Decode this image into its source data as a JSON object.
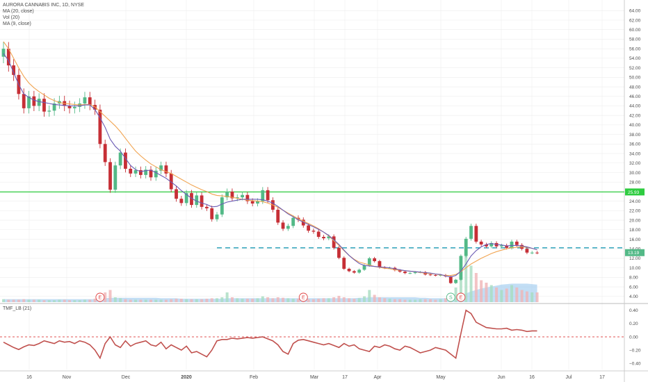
{
  "legend": {
    "title": "AURORA CANNABIS INC, 1D, NYSE",
    "ma20": "MA (20, close)",
    "vol": "Vol (20)",
    "ma9": "MA (9, close)"
  },
  "tmf_legend": "TMF_LB (21)",
  "colors": {
    "up": "#53b987",
    "down": "#c62f36",
    "ma20": "#f1a451",
    "ma9": "#6a5bb4",
    "support": "#2ecc40",
    "resistance": "#1d9bb5",
    "tmf": "#c0504d",
    "volume": "#90c2ec",
    "grid": "#eeeeee",
    "event_marker": "#e04040"
  },
  "chart_data": {
    "type": "candlestick",
    "title": "AURORA CANNABIS INC, 1D, NYSE",
    "y_ticks": [
      "64.00",
      "62.00",
      "60.00",
      "58.00",
      "56.00",
      "54.00",
      "52.00",
      "50.00",
      "48.00",
      "46.00",
      "44.00",
      "42.00",
      "40.00",
      "38.00",
      "36.00",
      "34.00",
      "32.00",
      "30.00",
      "28.00",
      "26.00",
      "24.00",
      "22.00",
      "20.00",
      "18.00",
      "16.00",
      "14.00",
      "12.00",
      "10.00",
      "8.00",
      "6.00",
      "4.00"
    ],
    "ylim": [
      2.8,
      65.5
    ],
    "x_labels": [
      "16",
      "Nov",
      "Dec",
      "2020",
      "Feb",
      "Mar",
      "17",
      "Apr",
      "May",
      "Jun",
      "16",
      "Jul",
      "17"
    ],
    "horizontal_lines": [
      {
        "price": 25.93,
        "label": "25.93",
        "style": "solid",
        "color": "#2ecc40"
      },
      {
        "price": 14.2,
        "label": "",
        "style": "dashed",
        "color": "#1d9bb5",
        "start_day": 42
      }
    ],
    "last_price_label": "13.19",
    "candles_close": [
      56.0,
      52.5,
      50.5,
      46.5,
      43.5,
      46.0,
      44.0,
      45.5,
      42.8,
      43.0,
      44.5,
      45.0,
      44.0,
      43.5,
      43.8,
      44.5,
      45.8,
      44.2,
      43.2,
      36.0,
      32.2,
      26.4,
      31.5,
      34.2,
      30.8,
      29.8,
      30.5,
      29.5,
      30.6,
      29.0,
      30.4,
      31.5,
      29.8,
      26.5,
      24.5,
      23.6,
      25.7,
      23.2,
      25.2,
      22.8,
      22.5,
      20.2,
      21.2,
      24.8,
      26.0,
      24.6,
      24.8,
      25.3,
      24.0,
      23.5,
      24.0,
      26.3,
      24.2,
      22.2,
      19.5,
      18.2,
      18.8,
      20.5,
      20.1,
      18.9,
      17.8,
      17.6,
      16.5,
      16.2,
      16.6,
      14.2,
      12.1,
      9.8,
      9.3,
      9.0,
      9.6,
      10.5,
      12.0,
      11.4,
      10.1,
      10.0,
      10.0,
      9.5,
      9.2,
      8.9,
      8.9,
      9.1,
      9.1,
      8.6,
      8.5,
      8.4,
      8.5,
      8.2,
      6.8,
      7.5,
      12.5,
      16.1,
      18.8,
      15.5,
      14.9,
      14.5,
      15.2,
      14.5,
      14.7,
      14.2,
      15.5,
      14.8,
      14.0,
      13.2,
      13.2,
      13.19
    ],
    "ma9": [
      55.0,
      53.5,
      51.0,
      48.5,
      46.5,
      45.8,
      45.2,
      44.9,
      44.7,
      44.5,
      44.3,
      44.2,
      44.1,
      44.0,
      44.0,
      44.0,
      44.2,
      44.2,
      43.2,
      41.5,
      39.5,
      37.0,
      35.5,
      34.5,
      33.0,
      31.5,
      30.6,
      30.2,
      30.4,
      30.5,
      30.0,
      29.4,
      28.8,
      28.0,
      27.2,
      26.2,
      25.4,
      24.6,
      24.0,
      23.6,
      23.3,
      22.8,
      22.9,
      23.4,
      23.8,
      24.0,
      24.2,
      24.4,
      24.4,
      24.4,
      24.4,
      24.3,
      24.0,
      23.6,
      22.9,
      22.1,
      21.3,
      20.7,
      20.1,
      19.6,
      19.1,
      18.6,
      18.1,
      17.5,
      16.8,
      15.9,
      14.9,
      13.7,
      12.6,
      11.7,
      10.9,
      10.5,
      10.4,
      10.3,
      10.2,
      10.1,
      10.0,
      9.8,
      9.6,
      9.4,
      9.3,
      9.2,
      9.1,
      9.0,
      8.9,
      8.7,
      8.6,
      8.3,
      8.1,
      8.4,
      9.3,
      10.8,
      12.5,
      13.6,
      14.4,
      14.9,
      15.1,
      14.9,
      14.8,
      14.6,
      14.7,
      14.7,
      14.6,
      14.4,
      14.1,
      13.8
    ],
    "ma20": [
      57.5,
      56.0,
      54.0,
      52.0,
      50.2,
      48.8,
      47.8,
      47.0,
      46.3,
      45.6,
      45.1,
      44.7,
      44.5,
      44.4,
      44.3,
      44.2,
      44.3,
      44.3,
      43.8,
      42.8,
      41.8,
      40.8,
      39.8,
      38.6,
      37.2,
      35.8,
      34.5,
      33.5,
      32.6,
      31.8,
      31.2,
      30.6,
      30.2,
      29.8,
      29.2,
      28.6,
      28.0,
      27.4,
      26.9,
      26.4,
      26.0,
      25.5,
      25.2,
      25.1,
      25.0,
      24.8,
      24.6,
      24.4,
      24.2,
      24.1,
      24.0,
      23.9,
      23.6,
      23.2,
      22.7,
      22.1,
      21.5,
      20.9,
      20.3,
      19.8,
      19.3,
      18.8,
      18.2,
      17.5,
      16.7,
      15.7,
      14.7,
      13.6,
      12.6,
      11.8,
      11.2,
      10.9,
      10.6,
      10.3,
      10.1,
      9.9,
      9.8,
      9.6,
      9.5,
      9.4,
      9.3,
      9.2,
      9.0,
      8.9,
      8.8,
      8.7,
      8.5,
      8.4,
      8.4,
      8.6,
      9.2,
      10.0,
      10.8,
      11.4,
      12.0,
      12.5,
      13.0,
      13.4,
      13.7,
      14.0,
      14.2,
      14.3,
      14.4,
      14.3,
      14.1,
      13.8
    ],
    "volume_relative": [
      0.06,
      0.05,
      0.05,
      0.05,
      0.06,
      0.05,
      0.05,
      0.05,
      0.04,
      0.04,
      0.04,
      0.05,
      0.05,
      0.04,
      0.04,
      0.04,
      0.05,
      0.05,
      0.07,
      0.14,
      0.2,
      0.25,
      0.1,
      0.08,
      0.06,
      0.05,
      0.05,
      0.05,
      0.05,
      0.05,
      0.05,
      0.05,
      0.05,
      0.06,
      0.07,
      0.07,
      0.06,
      0.06,
      0.06,
      0.06,
      0.07,
      0.08,
      0.08,
      0.1,
      0.2,
      0.1,
      0.08,
      0.07,
      0.07,
      0.07,
      0.08,
      0.12,
      0.1,
      0.08,
      0.1,
      0.09,
      0.08,
      0.07,
      0.07,
      0.06,
      0.06,
      0.06,
      0.07,
      0.08,
      0.08,
      0.1,
      0.13,
      0.1,
      0.08,
      0.07,
      0.08,
      0.12,
      0.25,
      0.15,
      0.1,
      0.08,
      0.07,
      0.06,
      0.06,
      0.05,
      0.05,
      0.05,
      0.06,
      0.06,
      0.06,
      0.05,
      0.06,
      0.08,
      0.15,
      0.3,
      0.9,
      1.0,
      0.75,
      0.6,
      0.45,
      0.4,
      0.35,
      0.3,
      0.25,
      0.28,
      0.35,
      0.3,
      0.25,
      0.22,
      0.2,
      0.2
    ],
    "volume_ma": [
      0.06,
      0.06,
      0.06,
      0.06,
      0.06,
      0.06,
      0.06,
      0.06,
      0.06,
      0.06,
      0.06,
      0.06,
      0.06,
      0.06,
      0.06,
      0.06,
      0.06,
      0.06,
      0.06,
      0.07,
      0.08,
      0.09,
      0.09,
      0.09,
      0.09,
      0.09,
      0.09,
      0.09,
      0.09,
      0.09,
      0.09,
      0.08,
      0.08,
      0.08,
      0.08,
      0.07,
      0.07,
      0.07,
      0.07,
      0.07,
      0.07,
      0.07,
      0.07,
      0.07,
      0.08,
      0.08,
      0.08,
      0.08,
      0.08,
      0.08,
      0.08,
      0.08,
      0.08,
      0.08,
      0.08,
      0.08,
      0.08,
      0.08,
      0.08,
      0.08,
      0.08,
      0.08,
      0.08,
      0.08,
      0.08,
      0.08,
      0.08,
      0.08,
      0.08,
      0.08,
      0.09,
      0.09,
      0.1,
      0.1,
      0.1,
      0.1,
      0.1,
      0.1,
      0.1,
      0.1,
      0.1,
      0.1,
      0.09,
      0.09,
      0.08,
      0.08,
      0.08,
      0.08,
      0.08,
      0.09,
      0.13,
      0.18,
      0.22,
      0.25,
      0.28,
      0.3,
      0.32,
      0.34,
      0.36,
      0.37,
      0.38,
      0.38,
      0.38,
      0.38,
      0.37,
      0.36
    ],
    "event_markers": [
      {
        "day": 19,
        "label": "E"
      },
      {
        "day": 59,
        "label": "E"
      },
      {
        "day": 88,
        "label": "S"
      },
      {
        "day": 90,
        "label": "E"
      }
    ],
    "tmf": {
      "y_ticks": [
        "0.40",
        "0.20",
        "0.00",
        "-0.20",
        "-0.40"
      ],
      "ylim": [
        -0.47,
        0.47
      ],
      "zero_line": 0.0,
      "values": [
        -0.08,
        -0.12,
        -0.16,
        -0.19,
        -0.15,
        -0.12,
        -0.13,
        -0.1,
        -0.06,
        -0.08,
        -0.1,
        -0.06,
        -0.08,
        -0.07,
        -0.1,
        -0.06,
        -0.08,
        -0.12,
        -0.2,
        -0.32,
        -0.1,
        0.0,
        -0.12,
        -0.16,
        -0.06,
        -0.14,
        -0.1,
        -0.08,
        -0.06,
        -0.12,
        -0.14,
        -0.08,
        -0.18,
        -0.12,
        -0.16,
        -0.2,
        -0.14,
        -0.24,
        -0.22,
        -0.26,
        -0.3,
        -0.2,
        -0.06,
        -0.04,
        -0.04,
        -0.02,
        -0.03,
        -0.02,
        -0.01,
        -0.02,
        -0.01,
        0.0,
        -0.03,
        -0.06,
        -0.12,
        -0.22,
        -0.26,
        -0.1,
        -0.05,
        -0.04,
        -0.06,
        -0.08,
        -0.1,
        -0.12,
        -0.1,
        -0.13,
        -0.16,
        -0.1,
        -0.14,
        -0.12,
        -0.18,
        -0.2,
        -0.22,
        -0.14,
        -0.16,
        -0.12,
        -0.14,
        -0.18,
        -0.2,
        -0.14,
        -0.16,
        -0.2,
        -0.24,
        -0.22,
        -0.2,
        -0.16,
        -0.18,
        -0.2,
        -0.26,
        -0.32,
        0.05,
        0.4,
        0.35,
        0.22,
        0.18,
        0.14,
        0.13,
        0.12,
        0.12,
        0.13,
        0.1,
        0.11,
        0.1,
        0.08,
        0.09,
        0.09
      ]
    }
  }
}
